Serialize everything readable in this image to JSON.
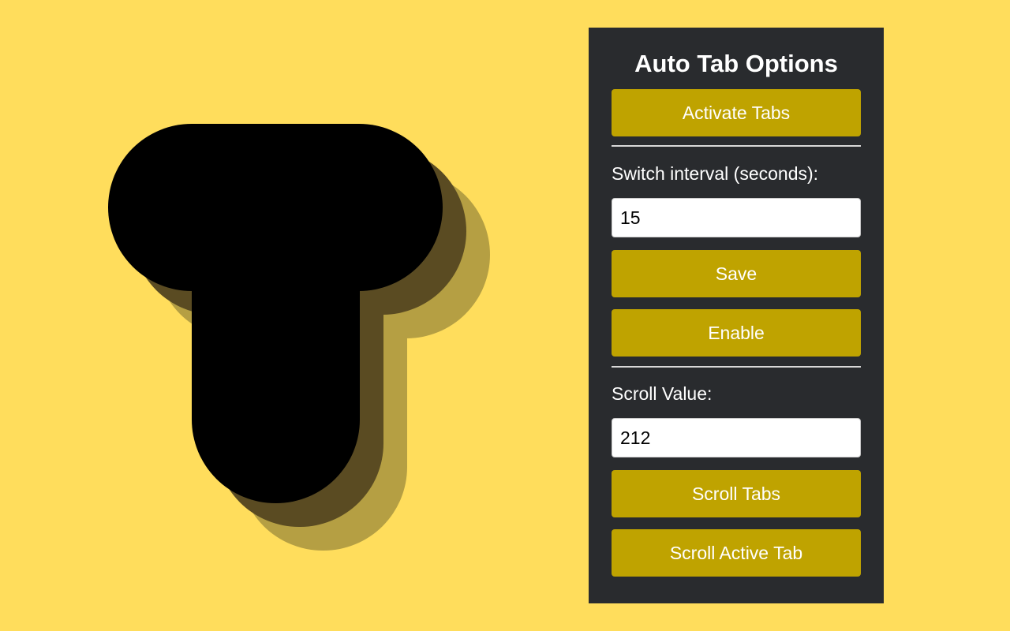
{
  "logo": {
    "icon": "t-logo-icon",
    "colors": {
      "main": "#000000",
      "shadow1": "#5A4B22",
      "shadow2": "#B59F43"
    }
  },
  "panel": {
    "title": "Auto Tab Options",
    "activate_label": "Activate Tabs",
    "interval_label": "Switch interval (seconds):",
    "interval_value": "15",
    "save_label": "Save",
    "enable_label": "Enable",
    "scroll_label": "Scroll Value:",
    "scroll_value": "212",
    "scroll_tabs_label": "Scroll Tabs",
    "scroll_active_label": "Scroll Active Tab"
  },
  "colors": {
    "background": "#FFDD5C",
    "panel": "#292B2E",
    "button": "#BFA300",
    "text": "#FFFFFF"
  }
}
